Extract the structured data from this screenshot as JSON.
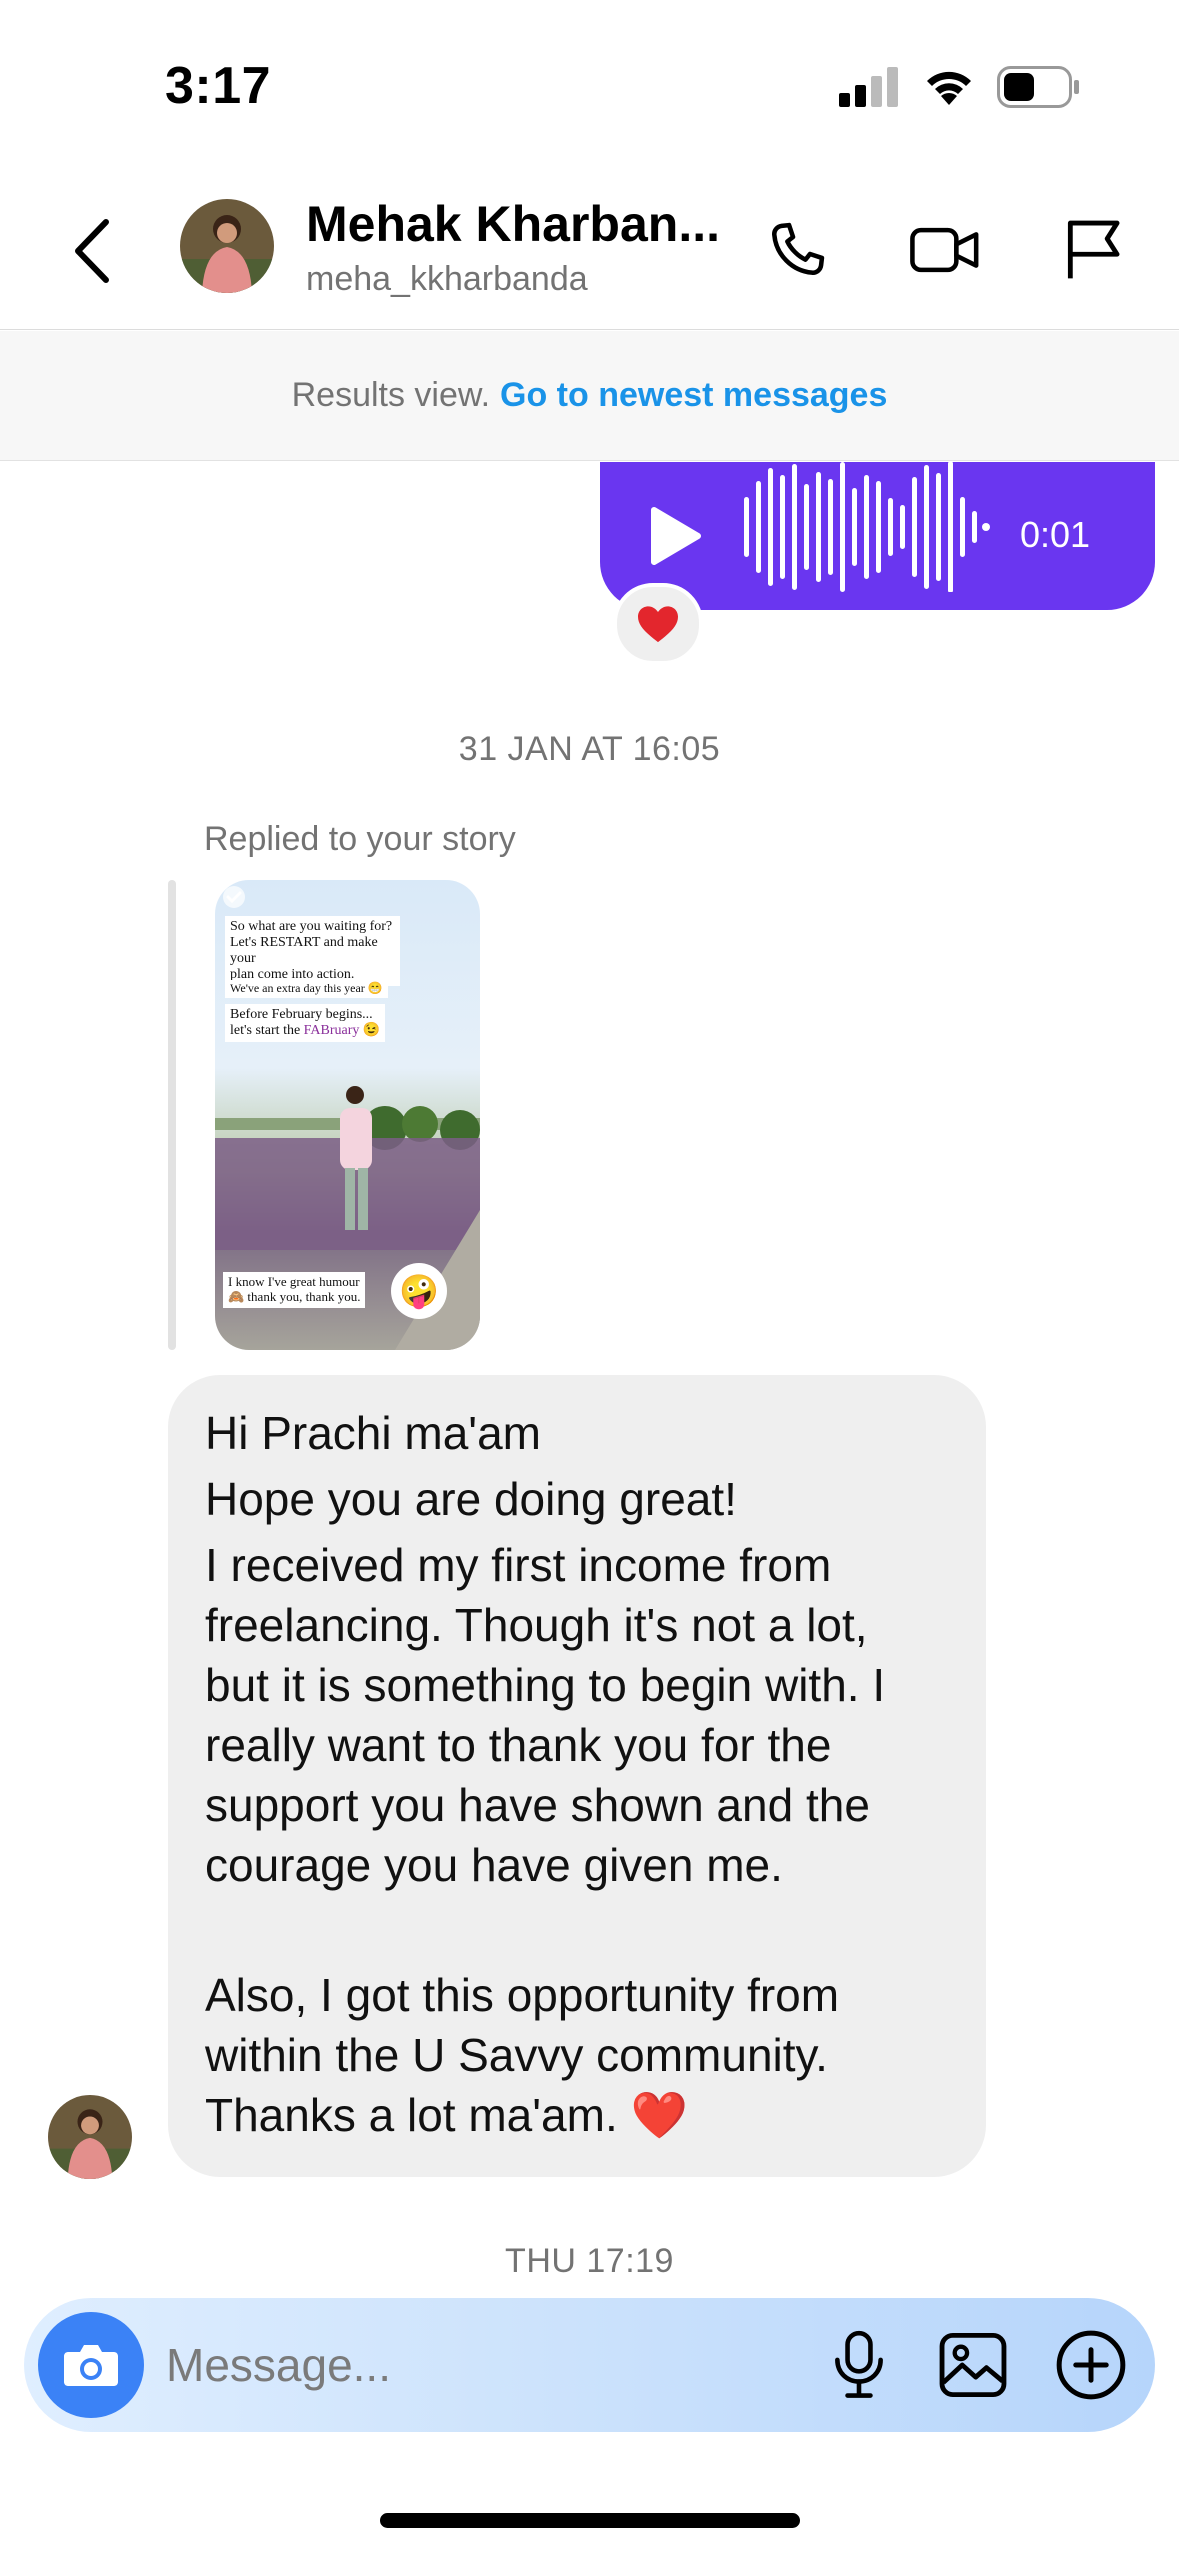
{
  "status_bar": {
    "time": "3:17"
  },
  "header": {
    "back_icon": "chevron-left-icon",
    "name": "Mehak Kharban...",
    "handle": "meha_kkharbanda",
    "icons": [
      "phone-icon",
      "video-camera-icon",
      "flag-icon"
    ]
  },
  "results_banner": {
    "text": "Results view.",
    "link": "Go to newest messages"
  },
  "voice_message": {
    "duration": "0:01",
    "reaction": "❤️",
    "color": "#6a36f0"
  },
  "timestamps": {
    "first": "31 JAN AT 16:05",
    "second": "THU 17:19"
  },
  "story_reply": {
    "label": "Replied to your story",
    "card1_lines": [
      "So what are you waiting for?",
      "Let's RESTART and make your",
      "plan come into action."
    ],
    "card2": "We've an extra day this year 😁",
    "card3_line1": "Before February begins...",
    "card3_prefix": "let's start the ",
    "card3_highlight": "FABruary",
    "card3_emoji": "😉",
    "card4_lines": [
      "I know I've great humour",
      "🙈 thank you, thank you."
    ],
    "sticker": "🤪"
  },
  "message": {
    "lines": [
      "Hi Prachi ma'am",
      "Hope you are doing great!",
      "I received my first income from",
      "freelancing. Though it's not a lot,",
      "but it is something to begin with. I",
      "really want to thank you for the",
      "support you have shown and the",
      "courage you have given me."
    ],
    "lines2": [
      "Also, I got this opportunity from",
      "within the U Savvy community.",
      "Thanks a lot ma'am. ❤️"
    ]
  },
  "composer": {
    "placeholder": "Message...",
    "icons": [
      "camera-icon",
      "microphone-icon",
      "gallery-icon",
      "plus-circle-icon"
    ],
    "accent": "#3b82f6"
  }
}
